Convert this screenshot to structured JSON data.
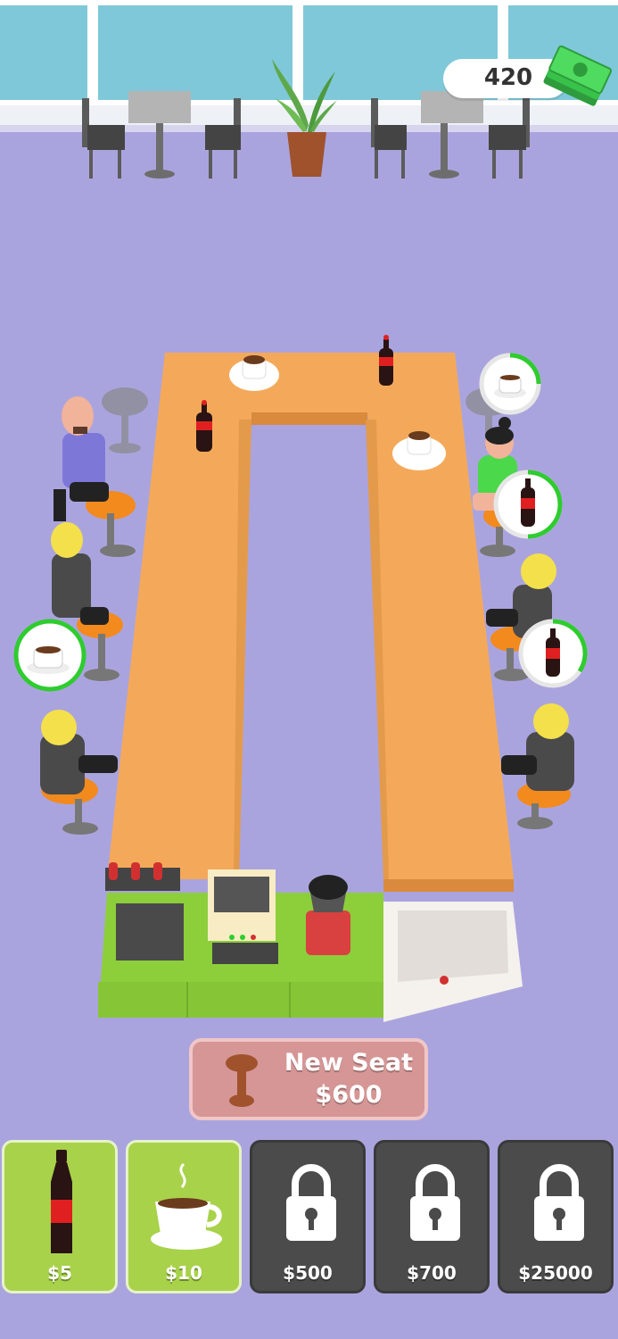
{
  "hud": {
    "money": "420",
    "money_icon": "cash-stack-icon"
  },
  "new_seat": {
    "label": "New Seat",
    "price": "$600",
    "icon": "stool-icon"
  },
  "drinks": [
    {
      "name": "cola",
      "price": "$5",
      "locked": false,
      "icon": "cola-bottle-icon"
    },
    {
      "name": "coffee",
      "price": "$10",
      "locked": false,
      "icon": "coffee-cup-icon"
    },
    {
      "name": "locked-drink-1",
      "price": "$500",
      "locked": true,
      "icon": "lock-icon"
    },
    {
      "name": "locked-drink-2",
      "price": "$700",
      "locked": true,
      "icon": "lock-icon"
    },
    {
      "name": "locked-drink-3",
      "price": "$25000",
      "locked": true,
      "icon": "lock-icon"
    }
  ],
  "orders": [
    {
      "customer": "right-top",
      "item": "coffee-cup-icon",
      "progress": 0.3
    },
    {
      "customer": "right-mid",
      "item": "cola-bottle-icon",
      "progress": 0.55
    },
    {
      "customer": "right-low",
      "item": "cola-bottle-icon",
      "progress": 0.4
    },
    {
      "customer": "left-mid",
      "item": "coffee-cup-icon",
      "progress": 0.85
    }
  ],
  "colors": {
    "floor": "#aaa4de",
    "counter": "#f4a95a",
    "unlocked_card": "#a8d24a",
    "locked_card": "#4b4b4b",
    "new_seat_button": "#d69696",
    "progress_ring": "#2ecc2e",
    "money_green": "#38c24a"
  }
}
